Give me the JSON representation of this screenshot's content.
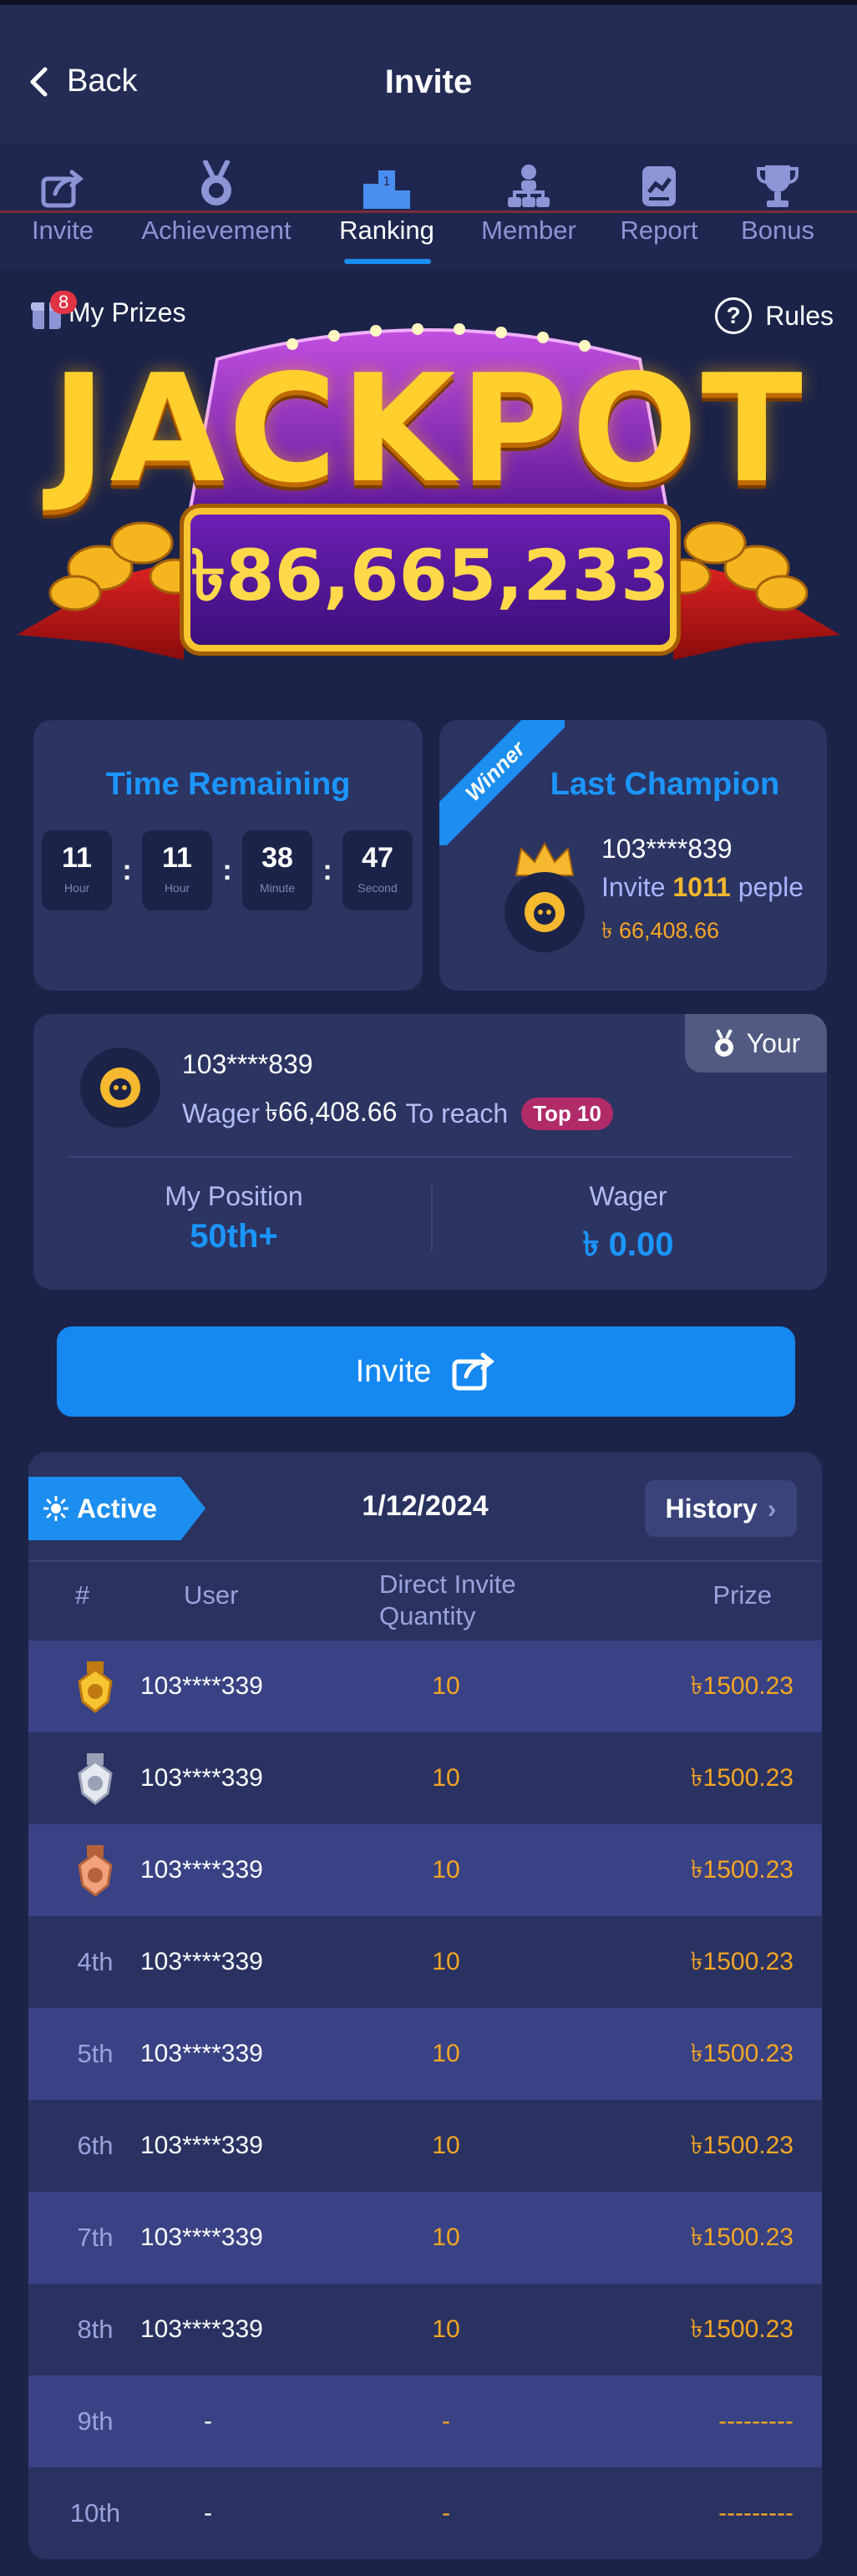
{
  "header": {
    "back_label": "Back",
    "title": "Invite"
  },
  "tabs": [
    {
      "label": "Invite",
      "icon": "share-icon",
      "active": false
    },
    {
      "label": "Achievement",
      "icon": "medal-icon",
      "active": false
    },
    {
      "label": "Ranking",
      "icon": "podium-icon",
      "active": true
    },
    {
      "label": "Member",
      "icon": "hierarchy-icon",
      "active": false
    },
    {
      "label": "Report",
      "icon": "report-icon",
      "active": false
    },
    {
      "label": "Bonus",
      "icon": "trophy-icon",
      "active": false
    }
  ],
  "banner": {
    "my_prizes_label": "My Prizes",
    "my_prizes_count": "8",
    "rules_label": "Rules",
    "jackpot_title": "JACKPOT",
    "jackpot_amount": "৳86,665,233"
  },
  "timer": {
    "title": "Time Remaining",
    "units": [
      {
        "value": "11",
        "unit": "Hour"
      },
      {
        "value": "11",
        "unit": "Hour"
      },
      {
        "value": "38",
        "unit": "Minute"
      },
      {
        "value": "47",
        "unit": "Second"
      }
    ]
  },
  "champion": {
    "ribbon": "Winner",
    "title": "Last Champion",
    "user": "103****839",
    "invite_prefix": "Invite",
    "invite_count": "1011",
    "invite_suffix": "peple",
    "amount": "৳ 66,408.66"
  },
  "me": {
    "tag": "Your",
    "user": "103****839",
    "wager_prefix": "Wager",
    "wager_value": "৳66,408.66",
    "reach_text": "To reach",
    "reach_badge": "Top 10",
    "position_label": "My Position",
    "position_value": "50th+",
    "wager_label": "Wager",
    "wager_total": "৳ 0.00"
  },
  "invite_button": {
    "label": "Invite"
  },
  "ranking": {
    "status": "Active",
    "date": "1/12/2024",
    "history_label": "History",
    "columns": {
      "rank": "#",
      "user": "User",
      "qty_line1": "Direct Invite",
      "qty_line2": "Quantity",
      "prize": "Prize"
    },
    "rows": [
      {
        "rank": "",
        "medal": "gold",
        "user": "103****339",
        "qty": "10",
        "prize": "৳1500.23"
      },
      {
        "rank": "",
        "medal": "silver",
        "user": "103****339",
        "qty": "10",
        "prize": "৳1500.23"
      },
      {
        "rank": "",
        "medal": "bronze",
        "user": "103****339",
        "qty": "10",
        "prize": "৳1500.23"
      },
      {
        "rank": "4th",
        "medal": "",
        "user": "103****339",
        "qty": "10",
        "prize": "৳1500.23"
      },
      {
        "rank": "5th",
        "medal": "",
        "user": "103****339",
        "qty": "10",
        "prize": "৳1500.23"
      },
      {
        "rank": "6th",
        "medal": "",
        "user": "103****339",
        "qty": "10",
        "prize": "৳1500.23"
      },
      {
        "rank": "7th",
        "medal": "",
        "user": "103****339",
        "qty": "10",
        "prize": "৳1500.23"
      },
      {
        "rank": "8th",
        "medal": "",
        "user": "103****339",
        "qty": "10",
        "prize": "৳1500.23"
      },
      {
        "rank": "9th",
        "medal": "",
        "user": "-",
        "qty": "-",
        "prize": "---------"
      },
      {
        "rank": "10th",
        "medal": "",
        "user": "-",
        "qty": "-",
        "prize": "---------"
      }
    ]
  },
  "colors": {
    "accent": "#1b8ef0",
    "gold": "#f5a623",
    "bg": "#1c2348",
    "card": "#2c3462"
  }
}
